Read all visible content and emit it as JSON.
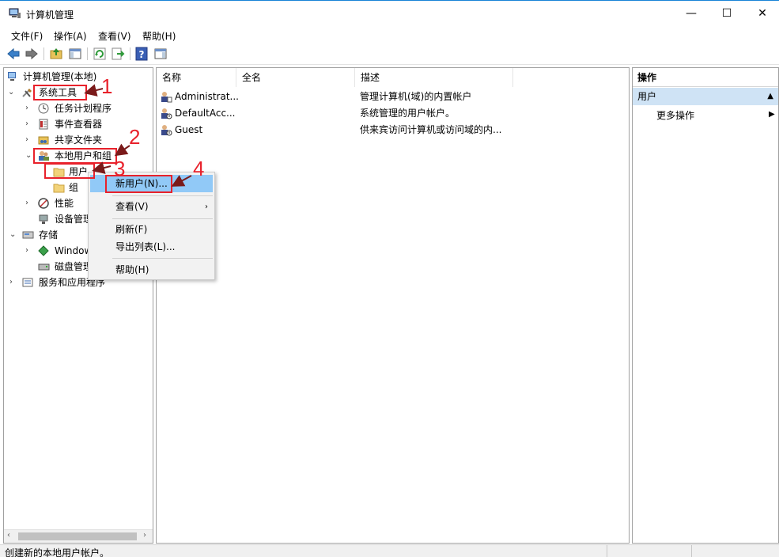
{
  "window": {
    "title": "计算机管理",
    "minimize": "—",
    "maximize": "☐",
    "close": "✕"
  },
  "menu": [
    "文件(F)",
    "操作(A)",
    "查看(V)",
    "帮助(H)"
  ],
  "tree": {
    "root": "计算机管理(本地)",
    "system_tools": "系统工具",
    "task_scheduler": "任务计划程序",
    "event_viewer": "事件查看器",
    "shared_folders": "共享文件夹",
    "local_users_groups": "本地用户和组",
    "users": "用户",
    "groups": "组",
    "performance": "性能",
    "device_manager": "设备管理",
    "storage": "存储",
    "windows_backup": "Window",
    "disk_management": "磁盘管理",
    "services_apps": "服务和应用程序"
  },
  "list": {
    "columns": [
      "名称",
      "全名",
      "描述"
    ],
    "rows": [
      {
        "name": "Administrat...",
        "fullname": "",
        "description": "管理计算机(域)的内置帐户"
      },
      {
        "name": "DefaultAcc...",
        "fullname": "",
        "description": "系统管理的用户帐户。"
      },
      {
        "name": "Guest",
        "fullname": "",
        "description": "供来宾访问计算机或访问域的内..."
      }
    ]
  },
  "actions": {
    "header": "操作",
    "section": "用户",
    "more": "更多操作"
  },
  "context_menu": {
    "new_user": "新用户(N)...",
    "view": "查看(V)",
    "refresh": "刷新(F)",
    "export": "导出列表(L)...",
    "help": "帮助(H)"
  },
  "annotations": [
    "1",
    "2",
    "3",
    "4"
  ],
  "status": "创建新的本地用户帐户。",
  "colors": {
    "annotation": "#e8212b",
    "highlight": "#91c9f7",
    "action_section": "#cfe3f5"
  }
}
